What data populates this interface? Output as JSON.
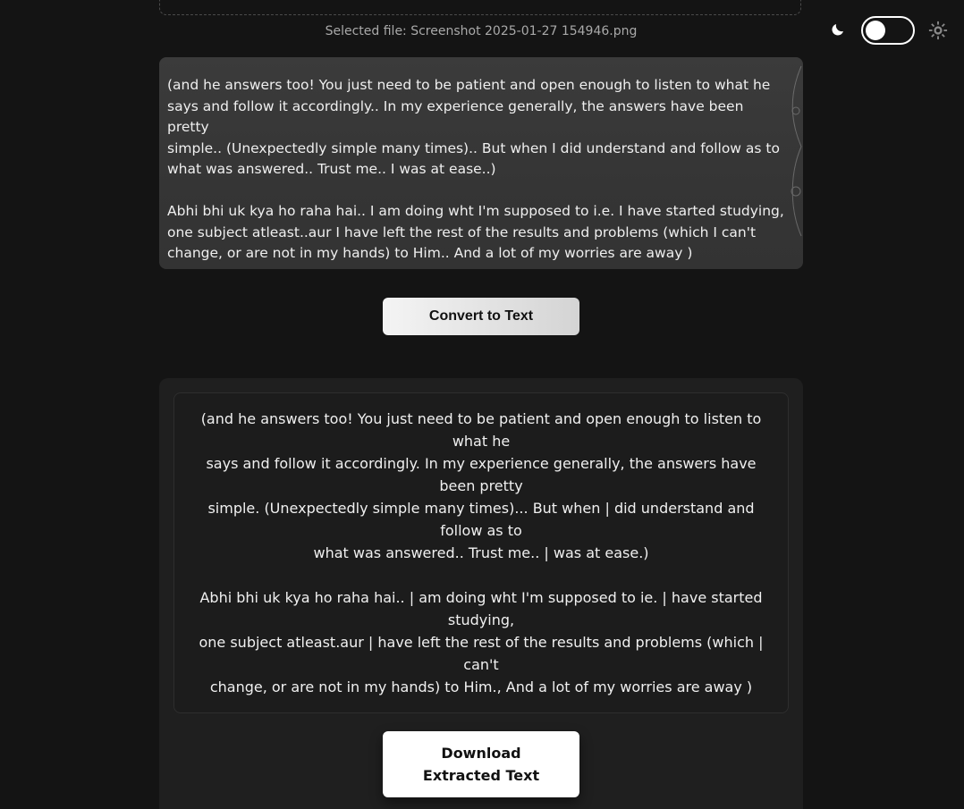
{
  "file": {
    "selected_label": "Selected file: Screenshot 2025-01-27 154946.png"
  },
  "theme": {
    "dark_icon": "moon-icon",
    "light_icon": "sun-icon",
    "toggle_state": "dark"
  },
  "preview": {
    "text": "(and he answers too! You just need to be patient and open enough to listen to what he\nsays and follow it accordingly.. In my experience generally, the answers have been pretty\nsimple.. (Unexpectedly simple many times).. But when I did understand and follow as to\nwhat was answered.. Trust me.. I was at ease..)\n\nAbhi bhi uk kya ho raha hai.. I am doing wht I'm supposed to i.e. I have started studying,\none subject atleast..aur I have left the rest of the results and problems (which I can't\nchange, or are not in my hands) to Him.. And a lot of my worries are away )"
  },
  "actions": {
    "convert_label": "Convert to Text",
    "download_label": "Download Extracted Text"
  },
  "result": {
    "text": "(and he answers too! You just need to be patient and open enough to listen to what he\nsays and follow it accordingly. In my experience generally, the answers have been pretty\nsimple. (Unexpectedly simple many times)... But when | did understand and follow as to\nwhat was answered.. Trust me.. | was at ease.)\n\nAbhi bhi uk kya ho raha hai.. | am doing wht I'm supposed to ie. | have started studying,\none subject atleast.aur | have left the rest of the results and problems (which | can't\nchange, or are not in my hands) to Him., And a lot of my worries are away )"
  },
  "colors": {
    "background": "#141414",
    "card": "#1f1f1f",
    "button_light": "#ffffff"
  }
}
